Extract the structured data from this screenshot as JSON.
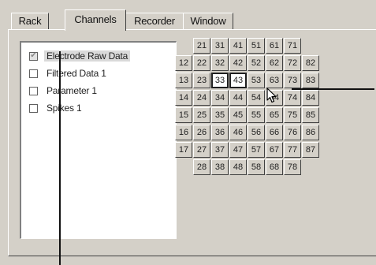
{
  "tabs": [
    {
      "label": "Rack"
    },
    {
      "label": "Channels"
    },
    {
      "label": "Recorder"
    },
    {
      "label": "Window"
    }
  ],
  "active_tab": "Channels",
  "streams": [
    {
      "label": "Electrode Raw Data",
      "checked": true,
      "selected": true
    },
    {
      "label": "Filtered Data 1",
      "checked": false
    },
    {
      "label": "Parameter 1",
      "checked": false
    },
    {
      "label": "Spikes 1",
      "checked": false
    }
  ],
  "channels": {
    "row1": [
      "21",
      "31",
      "41",
      "51",
      "61",
      "71"
    ],
    "row2": [
      "12",
      "22",
      "32",
      "42",
      "52",
      "62",
      "72",
      "82"
    ],
    "row3": [
      "13",
      "23",
      "33",
      "43",
      "53",
      "63",
      "73",
      "83"
    ],
    "row4": [
      "14",
      "24",
      "34",
      "44",
      "54",
      "64",
      "74",
      "84"
    ],
    "row5": [
      "15",
      "25",
      "35",
      "45",
      "55",
      "65",
      "75",
      "85"
    ],
    "row6": [
      "16",
      "26",
      "36",
      "46",
      "56",
      "66",
      "76",
      "86"
    ],
    "row7": [
      "17",
      "27",
      "37",
      "47",
      "57",
      "67",
      "77",
      "87"
    ],
    "row8": [
      "28",
      "38",
      "48",
      "58",
      "68",
      "78"
    ],
    "highlighted": [
      "33",
      "43"
    ]
  },
  "icons": {
    "cursor": "arrow-cursor-icon",
    "check": "checkmark-icon"
  }
}
